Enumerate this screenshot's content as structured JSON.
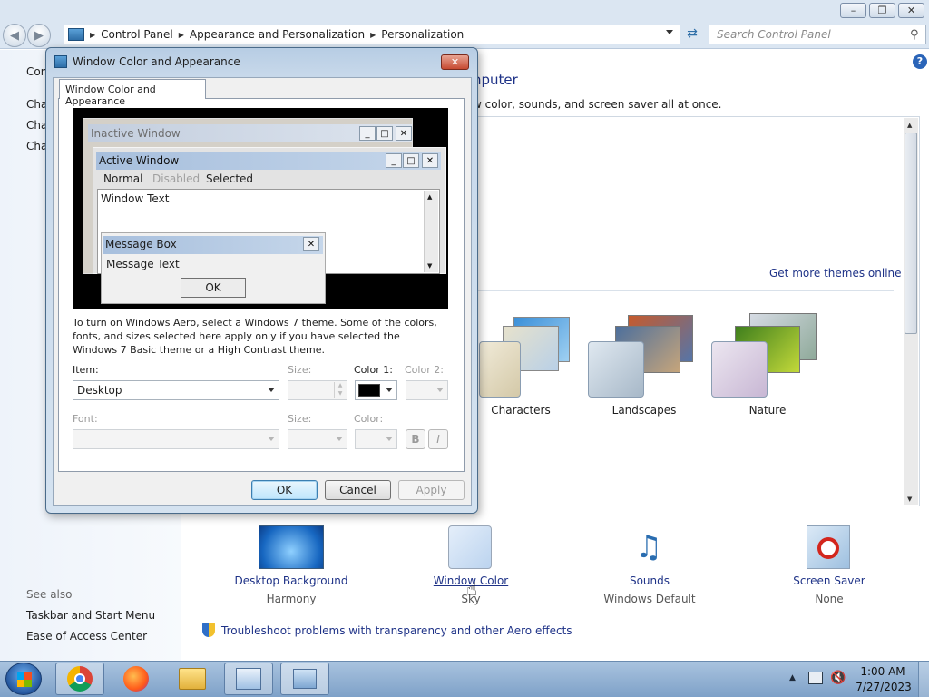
{
  "breadcrumb": [
    "Control Panel",
    "Appearance and Personalization",
    "Personalization"
  ],
  "search": {
    "placeholder": "Search Control Panel"
  },
  "cp_window": {
    "left_partial": [
      "Con",
      "Cha",
      "Cha",
      "Cha"
    ],
    "heading_partial": "nputer",
    "subtext_partial": "w color, sounds, and screen saver all at once.",
    "get_more_themes": "Get more themes online",
    "themes": [
      "Characters",
      "Landscapes",
      "Nature"
    ],
    "see_also": {
      "title": "See also",
      "items": [
        "Taskbar and Start Menu",
        "Ease of Access Center"
      ]
    },
    "bottom_items": [
      {
        "title": "Desktop Background",
        "sub": "Harmony"
      },
      {
        "title": "Window Color",
        "sub": "Sky"
      },
      {
        "title": "Sounds",
        "sub": "Windows Default"
      },
      {
        "title": "Screen Saver",
        "sub": "None"
      }
    ],
    "troubleshoot_link": "Troubleshoot problems with transparency and other Aero effects"
  },
  "dialog": {
    "title": "Window Color and Appearance",
    "tab": "Window Color and Appearance",
    "preview": {
      "inactive_window": "Inactive Window",
      "active_window": "Active Window",
      "menu": [
        "Normal",
        "Disabled",
        "Selected"
      ],
      "window_text": "Window Text",
      "message_box": "Message Box",
      "message_text": "Message Text",
      "ok": "OK"
    },
    "info": "To turn on Windows Aero, select a Windows 7 theme.  Some of the colors, fonts, and sizes selected here apply only if you have selected the Windows 7 Basic theme or a High Contrast theme.",
    "item_label": "Item:",
    "item_value": "Desktop",
    "size_label": "Size:",
    "color1_label": "Color 1:",
    "color1_value": "#000000",
    "color2_label": "Color 2:",
    "font_label": "Font:",
    "font_size_label": "Size:",
    "font_color_label": "Color:",
    "bold": "B",
    "italic": "I",
    "buttons": {
      "ok": "OK",
      "cancel": "Cancel",
      "apply": "Apply"
    }
  },
  "taskbar": {
    "time": "1:00 AM",
    "date": "7/27/2023",
    "apps": [
      "Start",
      "Google Chrome",
      "Firefox",
      "File Explorer",
      "Control Panel",
      "Window Color and Appearance"
    ]
  }
}
